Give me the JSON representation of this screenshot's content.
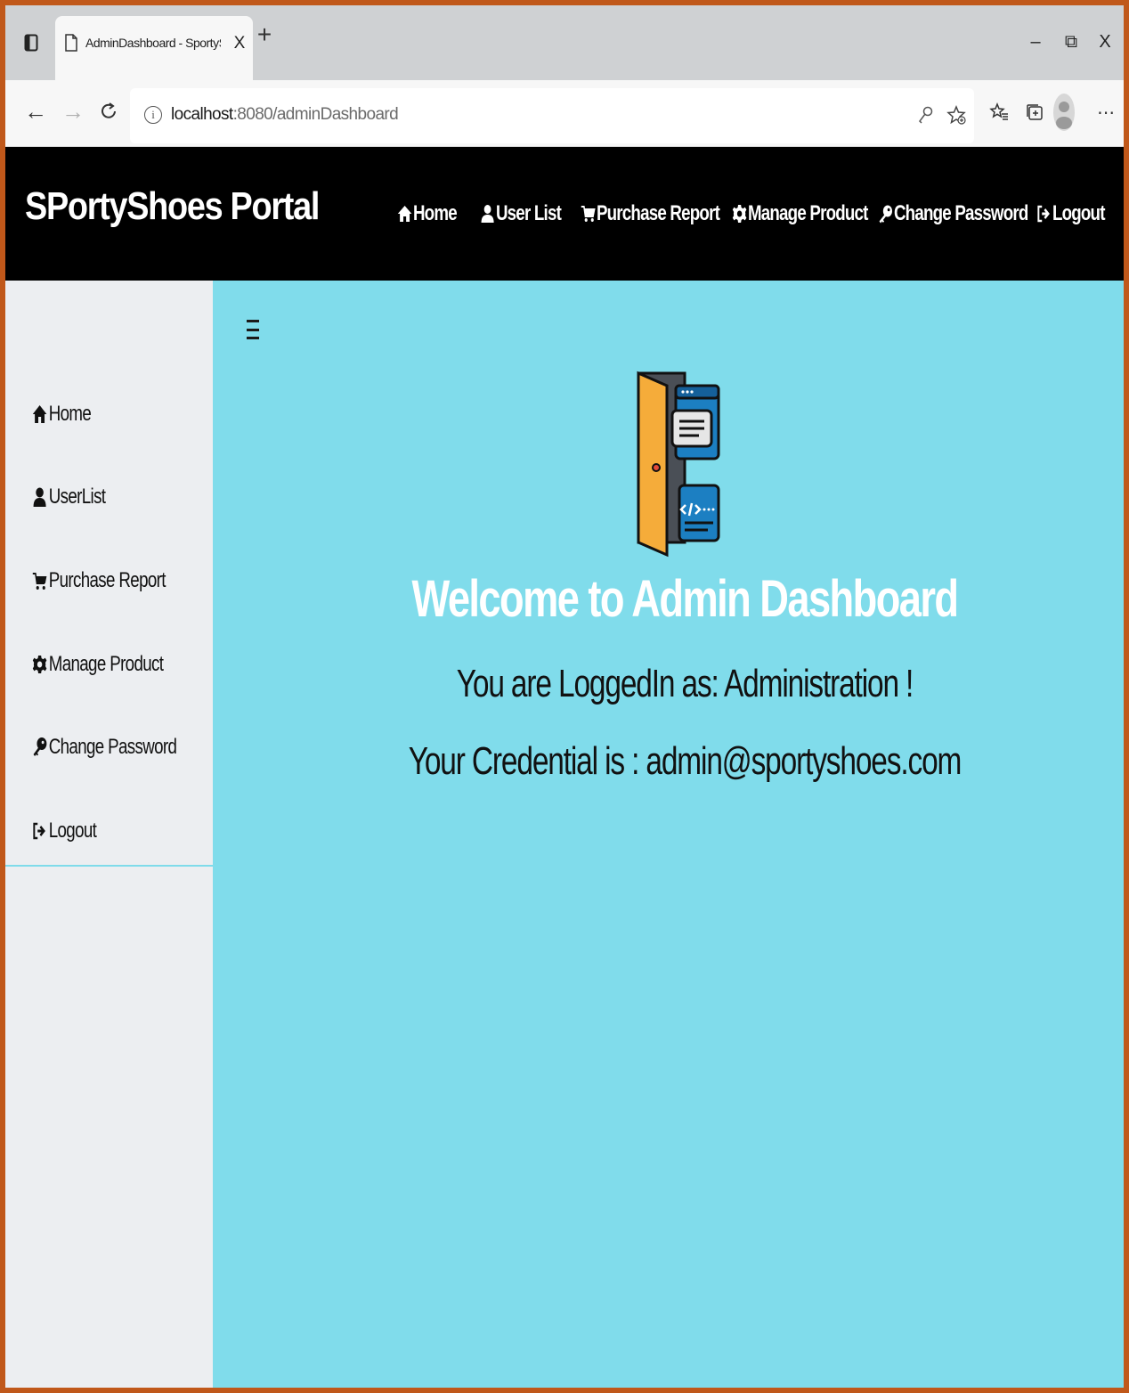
{
  "browser": {
    "tab_title": "AdminDashboard - SportyShoes",
    "tab_close": "X",
    "new_tab": "+",
    "window_controls": {
      "minimize": "–",
      "restore": "⧉",
      "close": "X"
    },
    "url_host": "localhost",
    "url_rest": ":8080/adminDashboard",
    "icons": [
      "tab-actions-icon",
      "page-icon",
      "back-arrow-icon",
      "forward-arrow-icon",
      "refresh-icon",
      "info-icon",
      "key-icon",
      "add-favorite-icon",
      "favorites-icon",
      "collections-icon",
      "profile-avatar-icon",
      "more-options-icon"
    ]
  },
  "header": {
    "brand": "SPortyShoes Portal",
    "nav": [
      {
        "label": "Home",
        "icon": "home-icon"
      },
      {
        "label": "User List",
        "icon": "user-icon"
      },
      {
        "label": "Purchase Report",
        "icon": "cart-icon"
      },
      {
        "label": "Manage Product",
        "icon": "gear-icon"
      },
      {
        "label": "Change Password",
        "icon": "key-icon"
      },
      {
        "label": "Logout",
        "icon": "logout-icon"
      }
    ]
  },
  "sidebar": {
    "items": [
      {
        "label": "Home",
        "icon": "home-icon"
      },
      {
        "label": "UserList",
        "icon": "user-icon"
      },
      {
        "label": "Purchase Report",
        "icon": "cart-icon"
      },
      {
        "label": "Manage Product",
        "icon": "gear-icon"
      },
      {
        "label": "Change Password",
        "icon": "key-icon"
      },
      {
        "label": "Logout",
        "icon": "logout-icon"
      }
    ]
  },
  "main": {
    "menu_icon": "hamburger-menu-icon",
    "illustration": "admin-door-code-icon",
    "welcome": "Welcome to Admin Dashboard",
    "logged_in": "You are LoggedIn as: Administration !",
    "credential": "Your Credential is : admin@sportyshoes.com"
  },
  "colors": {
    "frame_border": "#c0581a",
    "header_bg": "#000000",
    "sidebar_bg": "#eceef1",
    "main_bg": "#80dceb",
    "welcome_text": "#ffffff"
  }
}
